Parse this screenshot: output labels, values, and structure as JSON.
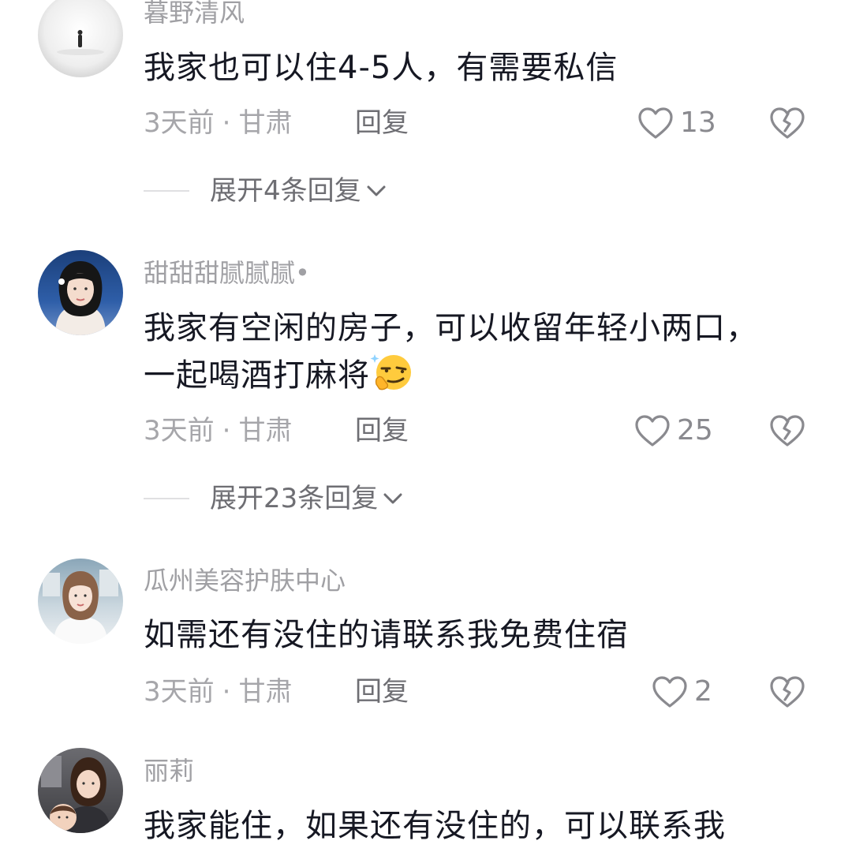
{
  "comments": [
    {
      "username": "暮野清风",
      "text": "我家也可以住4-5人，有需要私信",
      "time": "3天前",
      "location": "甘肃",
      "reply_label": "回复",
      "likes": "13",
      "expand_label": "展开4条回复"
    },
    {
      "username": "甜甜甜腻腻腻•",
      "text_line1": "我家有空闲的房子，可以收留年轻小两口，",
      "text_line2": "一起喝酒打麻将",
      "emoji_icon": "smirk-emoji-icon",
      "time": "3天前",
      "location": "甘肃",
      "reply_label": "回复",
      "likes": "25",
      "expand_label": "展开23条回复"
    },
    {
      "username": "瓜州美容护肤中心",
      "text": "如需还有没住的请联系我免费住宿",
      "time": "3天前",
      "location": "甘肃",
      "reply_label": "回复",
      "likes": "2"
    },
    {
      "username": "丽莉",
      "text": "我家能住，如果还有没住的，可以联系我"
    }
  ],
  "separator": "·",
  "icons": {
    "like": "heart-outline-icon",
    "dislike": "broken-heart-icon",
    "expand": "chevron-down-icon"
  },
  "colors": {
    "text_primary": "#161823",
    "text_secondary": "#a6a6aa",
    "icon": "#8a8a8f"
  }
}
